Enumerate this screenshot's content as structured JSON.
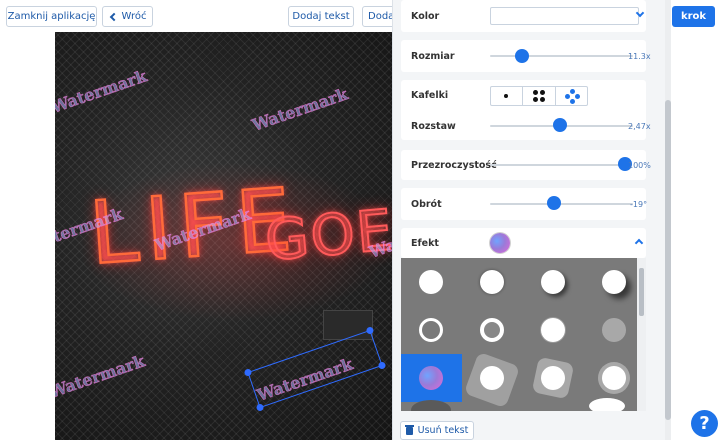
{
  "toolbar": {
    "close_label": "Zamknij aplikację",
    "back_label": "Wróć",
    "add_text_label": "Dodaj tekst",
    "add_image_label": "Dodaj",
    "next_label": "krok"
  },
  "watermark": {
    "text": "Watermark"
  },
  "panel": {
    "color": {
      "label": "Kolor",
      "value": ""
    },
    "size": {
      "label": "Rozmiar",
      "value_text": "11.3x",
      "fraction": 0.29
    },
    "tiles": {
      "label": "Kafelki",
      "options": [
        "single",
        "four",
        "diamond"
      ],
      "selected": "diamond"
    },
    "spacing": {
      "label": "Rozstaw",
      "value_text": "2,47x",
      "fraction": 0.46
    },
    "opacity": {
      "label": "Przezroczystość",
      "value_text": "100%",
      "fraction": 1.0
    },
    "rotation": {
      "label": "Obrót",
      "value_text": "-19°",
      "fraction": 0.45
    },
    "effect": {
      "label": "Efekt",
      "selected_index": 8
    },
    "remove_label": "Usuń tekst"
  },
  "help": {
    "label": "?"
  },
  "colors": {
    "accent": "#1e73e8",
    "link": "#1e5aa8"
  }
}
